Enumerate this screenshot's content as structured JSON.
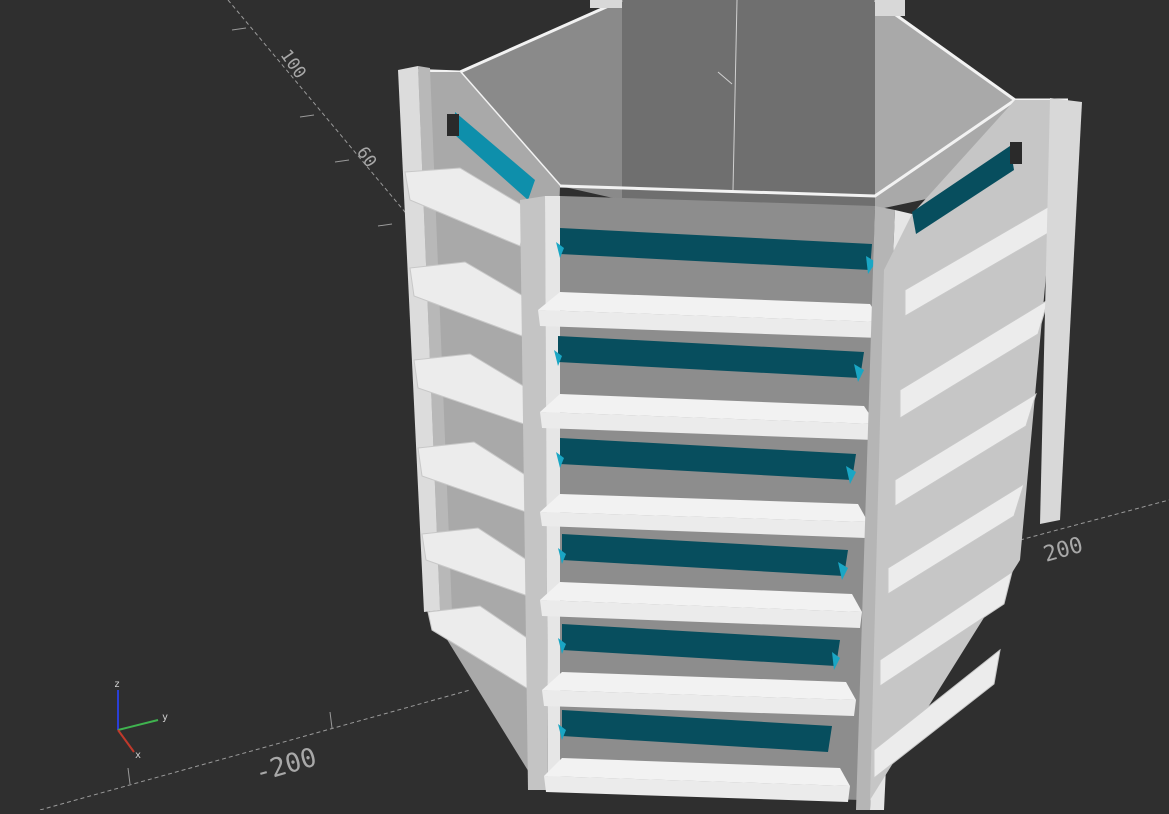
{
  "app": {
    "view": "3d-preview"
  },
  "scale_labels": {
    "y_100": "100",
    "y_60": "60",
    "x_neg200": "-200",
    "x_pos200": "200"
  },
  "axis_indicator": {
    "x": "x",
    "y": "y",
    "z": "z"
  },
  "colors": {
    "background": "#2f2f2f",
    "model_face_light": "#ececec",
    "model_face_mid": "#d6d6d6",
    "model_face_dark": "#9c9c9c",
    "slot_teal": "#074e5e",
    "slot_teal_bright": "#1aa6c4",
    "axis_x": "#c0392b",
    "axis_y": "#3fb34f",
    "axis_z": "#2a3fd6"
  }
}
